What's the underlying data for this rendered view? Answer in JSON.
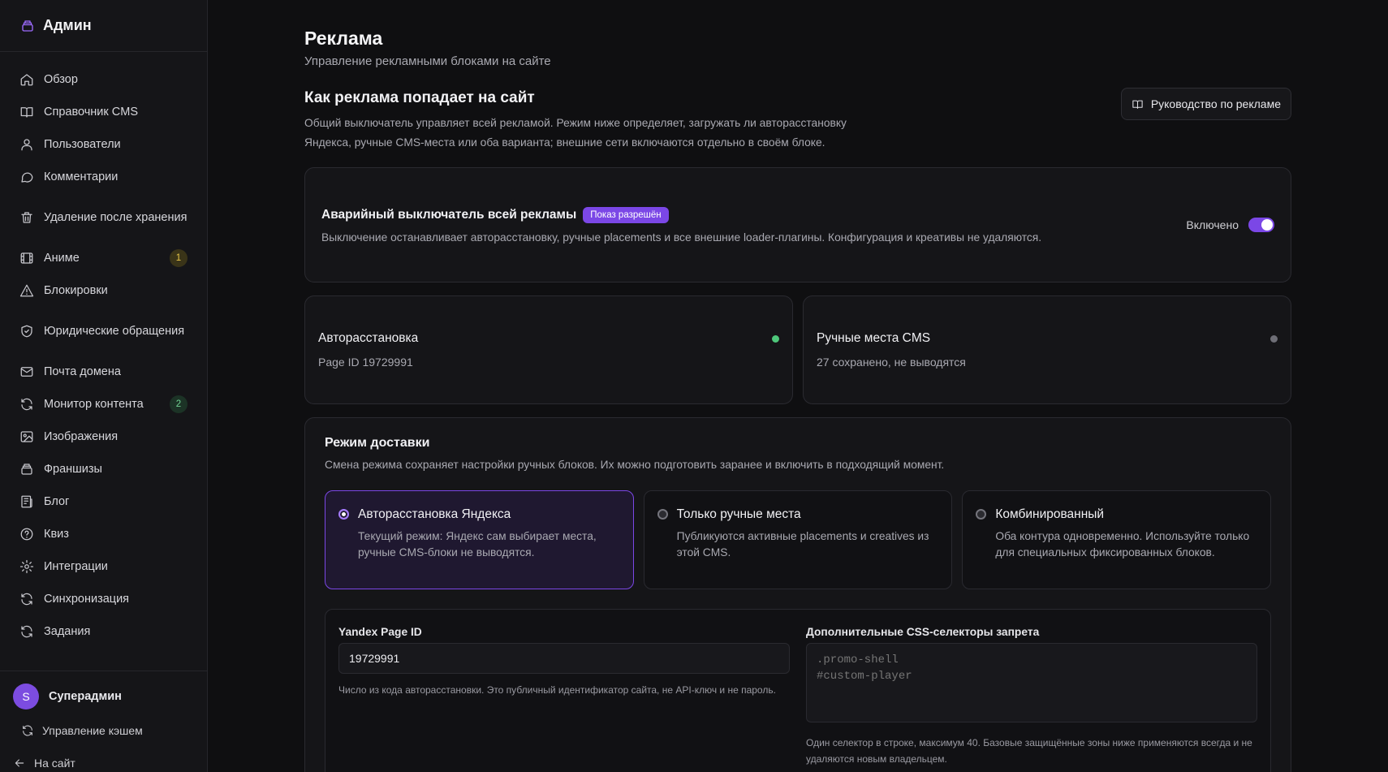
{
  "sidebar": {
    "brand": "Админ",
    "items": [
      {
        "label": "Обзор",
        "icon": "home-icon"
      },
      {
        "label": "Справочник CMS",
        "icon": "book-icon"
      },
      {
        "label": "Пользователи",
        "icon": "users-icon"
      },
      {
        "label": "Комментарии",
        "icon": "comment-icon"
      },
      {
        "label": "Удаление после хранения",
        "icon": "trash-icon"
      },
      {
        "label": "Аниме",
        "icon": "film-icon",
        "badge": "1"
      },
      {
        "label": "Блокировки",
        "icon": "warning-icon"
      },
      {
        "label": "Юридические обращения",
        "icon": "shield-icon"
      },
      {
        "label": "Почта домена",
        "icon": "mail-icon"
      },
      {
        "label": "Монитор контента",
        "icon": "refresh-icon",
        "badge": "2"
      },
      {
        "label": "Изображения",
        "icon": "image-icon"
      },
      {
        "label": "Франшизы",
        "icon": "layers-icon"
      },
      {
        "label": "Блог",
        "icon": "blog-icon"
      },
      {
        "label": "Квиз",
        "icon": "help-icon"
      },
      {
        "label": "Интеграции",
        "icon": "gear-icon"
      },
      {
        "label": "Синхронизация",
        "icon": "sync-icon"
      },
      {
        "label": "Задания",
        "icon": "tasks-icon"
      }
    ],
    "user": {
      "initial": "S",
      "name": "Суперадмин"
    },
    "cache_link": "Управление кэшем",
    "back_link": "На сайт"
  },
  "page": {
    "title": "Реклама",
    "subtitle": "Управление рекламными блоками на сайте"
  },
  "section": {
    "title": "Как реклама попадает на сайт",
    "desc": "Общий выключатель управляет всей рекламой. Режим ниже определяет, загружать ли авторасстановку Яндекса, ручные CMS-места или оба варианта; внешние сети включаются отдельно в своём блоке.",
    "guide_button": "Руководство по рекламе"
  },
  "kill_switch": {
    "title": "Аварийный выключатель всей рекламы",
    "pill": "Показ разрешён",
    "desc": "Выключение останавливает авторасстановку, ручные placements и все внешние loader-плагины. Конфигурация и креативы не удаляются.",
    "toggle_label": "Включено",
    "enabled": true
  },
  "status": {
    "auto": {
      "title": "Авторасстановка",
      "sub": "Page ID 19729991",
      "active": true
    },
    "manual": {
      "title": "Ручные места CMS",
      "sub": "27 сохранено, не выводятся",
      "active": false
    }
  },
  "delivery": {
    "title": "Режим доставки",
    "desc": "Смена режима сохраняет настройки ручных блоков. Их можно подготовить заранее и включить в подходящий момент.",
    "modes": [
      {
        "title": "Авторасстановка Яндекса",
        "desc": "Текущий режим: Яндекс сам выбирает места, ручные CMS-блоки не выводятся.",
        "selected": true
      },
      {
        "title": "Только ручные места",
        "desc": "Публикуются активные placements и creatives из этой CMS.",
        "selected": false
      },
      {
        "title": "Комбинированный",
        "desc": "Оба контура одновременно. Используйте только для специальных фиксированных блоков.",
        "selected": false
      }
    ]
  },
  "config": {
    "page_id_label": "Yandex Page ID",
    "page_id_value": "19729991",
    "page_id_hint": "Число из кода авторасстановки. Это публичный идентификатор сайта, не API-ключ и не пароль.",
    "css_label": "Дополнительные CSS-селекторы запрета",
    "css_placeholder": ".promo-shell\n#custom-player",
    "css_hint": "Один селектор в строке, максимум 40. Базовые защищённые зоны ниже применяются всегда и не удаляются новым владельцем."
  },
  "colors": {
    "accent": "#7b47e6",
    "status_on": "#4ec77a",
    "status_off": "#6e6e76"
  }
}
